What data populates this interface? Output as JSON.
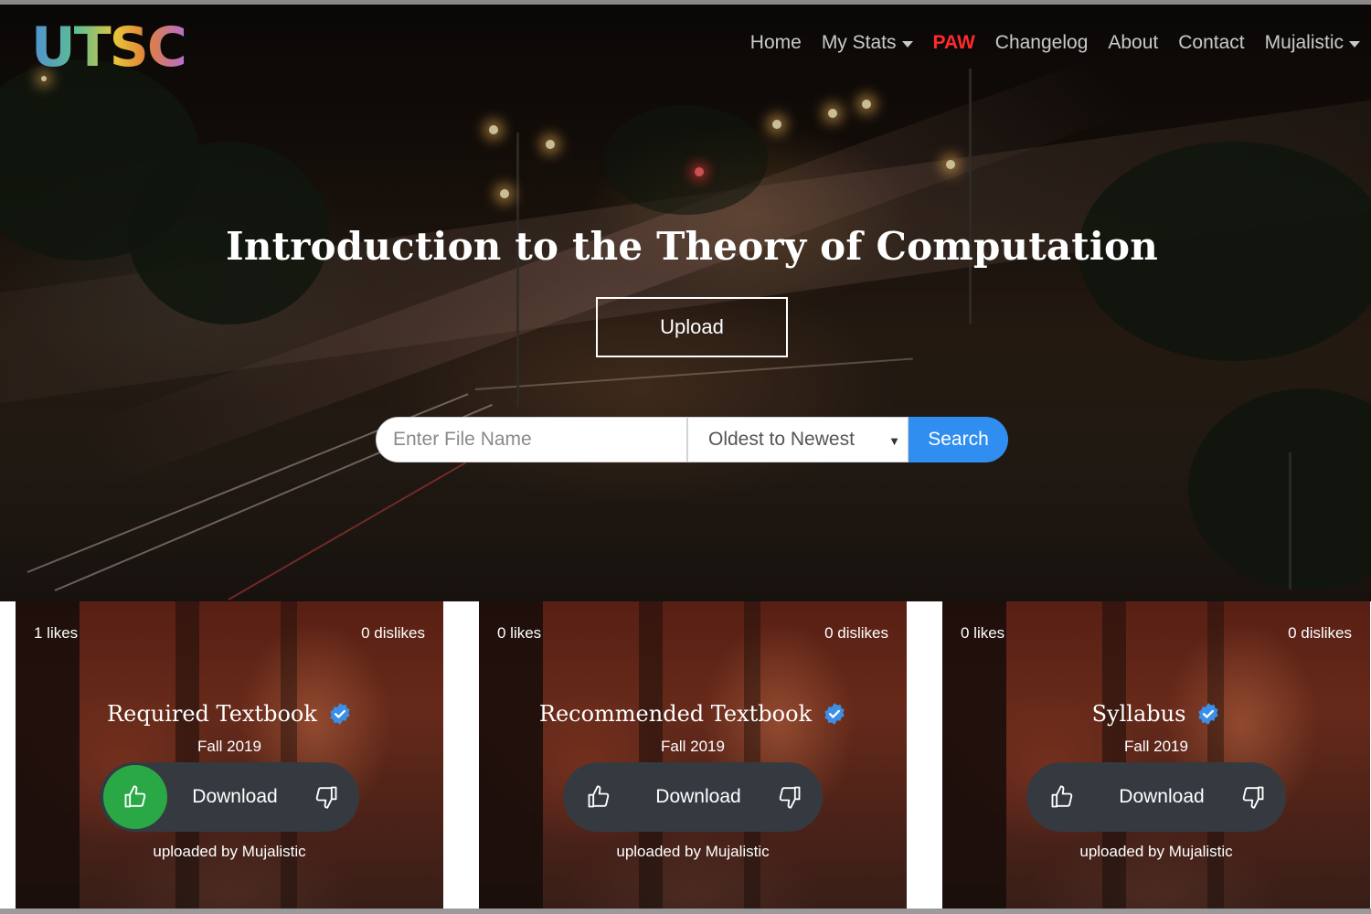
{
  "brand": {
    "logo_text": "UTSC"
  },
  "nav": {
    "items": [
      {
        "label": "Home",
        "dropdown": false,
        "active": false
      },
      {
        "label": "My Stats",
        "dropdown": true,
        "active": false
      },
      {
        "label": "PAW",
        "dropdown": false,
        "active": true
      },
      {
        "label": "Changelog",
        "dropdown": false,
        "active": false
      },
      {
        "label": "About",
        "dropdown": false,
        "active": false
      },
      {
        "label": "Contact",
        "dropdown": false,
        "active": false
      },
      {
        "label": "Mujalistic",
        "dropdown": true,
        "active": false
      }
    ]
  },
  "hero": {
    "title": "Introduction to the Theory of Computation",
    "upload_label": "Upload"
  },
  "search": {
    "placeholder": "Enter File Name",
    "value": "",
    "sort_selected": "Oldest to Newest",
    "button_label": "Search"
  },
  "cards": [
    {
      "likes": "1 likes",
      "dislikes": "0 dislikes",
      "title": "Required Textbook",
      "verified": true,
      "term": "Fall 2019",
      "download_label": "Download",
      "uploader": "uploaded by Mujalistic",
      "liked": true
    },
    {
      "likes": "0 likes",
      "dislikes": "0 dislikes",
      "title": "Recommended Textbook",
      "verified": true,
      "term": "Fall 2019",
      "download_label": "Download",
      "uploader": "uploaded by Mujalistic",
      "liked": false
    },
    {
      "likes": "0 likes",
      "dislikes": "0 dislikes",
      "title": "Syllabus",
      "verified": true,
      "term": "Fall 2019",
      "download_label": "Download",
      "uploader": "uploaded by Mujalistic",
      "liked": false
    }
  ],
  "colors": {
    "accent_active": "#ff2b2b",
    "search_button": "#2f8ef0",
    "liked_green": "#2aa845",
    "verified_blue": "#3b8fe8",
    "pill": "#353a40"
  },
  "icons": {
    "like": "thumbs-up-icon",
    "dislike": "thumbs-down-icon",
    "verified": "verified-badge-icon",
    "dropdown": "caret-down-icon"
  }
}
